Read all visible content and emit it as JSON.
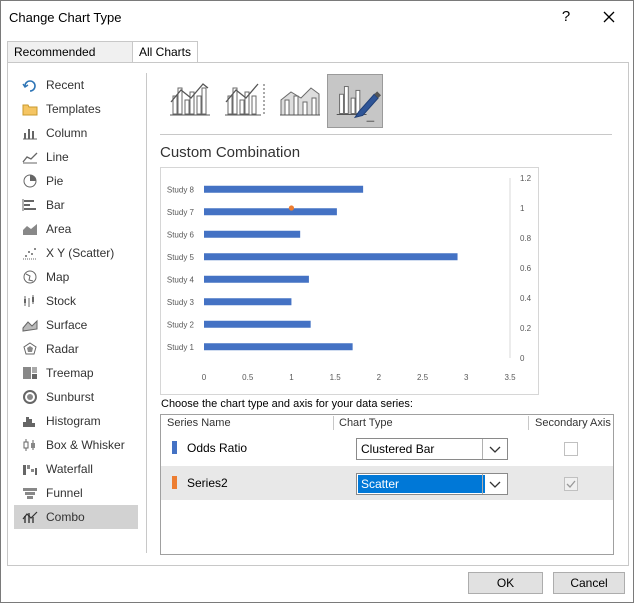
{
  "window": {
    "title": "Change Chart Type"
  },
  "tabs": [
    {
      "label": "Recommended Charts"
    },
    {
      "label": "All Charts"
    }
  ],
  "nav": {
    "items": [
      {
        "label": "Recent",
        "icon": "recent-icon"
      },
      {
        "label": "Templates",
        "icon": "folder-icon"
      },
      {
        "label": "Column",
        "icon": "column-chart-icon"
      },
      {
        "label": "Line",
        "icon": "line-chart-icon"
      },
      {
        "label": "Pie",
        "icon": "pie-chart-icon"
      },
      {
        "label": "Bar",
        "icon": "bar-chart-icon"
      },
      {
        "label": "Area",
        "icon": "area-chart-icon"
      },
      {
        "label": "X Y (Scatter)",
        "icon": "scatter-chart-icon"
      },
      {
        "label": "Map",
        "icon": "map-chart-icon"
      },
      {
        "label": "Stock",
        "icon": "stock-chart-icon"
      },
      {
        "label": "Surface",
        "icon": "surface-chart-icon"
      },
      {
        "label": "Radar",
        "icon": "radar-chart-icon"
      },
      {
        "label": "Treemap",
        "icon": "treemap-chart-icon"
      },
      {
        "label": "Sunburst",
        "icon": "sunburst-chart-icon"
      },
      {
        "label": "Histogram",
        "icon": "histogram-chart-icon"
      },
      {
        "label": "Box & Whisker",
        "icon": "box-whisker-chart-icon"
      },
      {
        "label": "Waterfall",
        "icon": "waterfall-chart-icon"
      },
      {
        "label": "Funnel",
        "icon": "funnel-chart-icon"
      },
      {
        "label": "Combo",
        "icon": "combo-chart-icon",
        "selected": true
      }
    ]
  },
  "subtypes": [
    {
      "icon": "clustered-column-line-icon"
    },
    {
      "icon": "clustered-column-line-secondary-icon"
    },
    {
      "icon": "stacked-area-clustered-column-icon"
    },
    {
      "icon": "custom-combination-icon",
      "selected": true
    }
  ],
  "section_title": "Custom Combination",
  "chart_data": {
    "type": "bar",
    "categories": [
      "Study 1",
      "Study 2",
      "Study 3",
      "Study 4",
      "Study 5",
      "Study 6",
      "Study 7",
      "Study 8"
    ],
    "series": [
      {
        "name": "Odds Ratio",
        "type": "bar",
        "color": "#4472c4",
        "values": [
          1.7,
          1.22,
          1.0,
          1.2,
          2.9,
          1.1,
          1.52,
          1.82
        ]
      },
      {
        "name": "Series2",
        "type": "scatter",
        "color": "#ed7d31",
        "points": [
          {
            "x": 1.0,
            "y": 1.0
          }
        ]
      }
    ],
    "x_ticks": [
      "0",
      "0.5",
      "1",
      "1.5",
      "2",
      "2.5",
      "3",
      "3.5"
    ],
    "xlim": [
      0,
      3.5
    ],
    "y2_ticks": [
      "0",
      "0.2",
      "0.4",
      "0.6",
      "0.8",
      "1",
      "1.2"
    ],
    "y2lim": [
      0,
      1.2
    ],
    "grid": false,
    "legend": "none"
  },
  "series_prompt": "Choose the chart type and axis for your data series:",
  "series_table": {
    "headers": {
      "name": "Series Name",
      "type": "Chart Type",
      "axis": "Secondary Axis"
    },
    "rows": [
      {
        "name": "Odds Ratio",
        "color": "#4472c4",
        "chart_type": "Clustered Bar",
        "secondary": false
      },
      {
        "name": "Series2",
        "color": "#ed7d31",
        "chart_type": "Scatter",
        "secondary": true,
        "selected": true
      }
    ]
  },
  "buttons": {
    "ok": "OK",
    "cancel": "Cancel"
  }
}
